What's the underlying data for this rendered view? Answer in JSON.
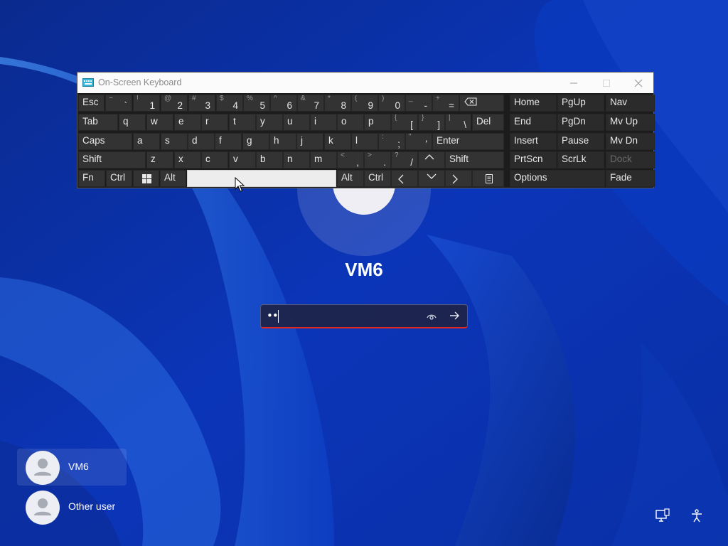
{
  "osk": {
    "title": "On-Screen Keyboard",
    "rows": [
      [
        {
          "id": "esc",
          "main": "Esc"
        },
        {
          "id": "backtick",
          "shift": "~",
          "main": "`"
        },
        {
          "id": "1",
          "shift": "!",
          "main": "1"
        },
        {
          "id": "2",
          "shift": "@",
          "main": "2"
        },
        {
          "id": "3",
          "shift": "#",
          "main": "3"
        },
        {
          "id": "4",
          "shift": "$",
          "main": "4"
        },
        {
          "id": "5",
          "shift": "%",
          "main": "5"
        },
        {
          "id": "6",
          "shift": "^",
          "main": "6"
        },
        {
          "id": "7",
          "shift": "&",
          "main": "7"
        },
        {
          "id": "8",
          "shift": "*",
          "main": "8"
        },
        {
          "id": "9",
          "shift": "(",
          "main": "9"
        },
        {
          "id": "0",
          "shift": ")",
          "main": "0"
        },
        {
          "id": "minus",
          "shift": "_",
          "main": "-"
        },
        {
          "id": "equals",
          "shift": "+",
          "main": "="
        },
        {
          "id": "backspace",
          "icon": "backspace-icon"
        }
      ],
      [
        {
          "id": "tab",
          "main": "Tab"
        },
        {
          "id": "q",
          "main": "q"
        },
        {
          "id": "w",
          "main": "w"
        },
        {
          "id": "e",
          "main": "e"
        },
        {
          "id": "r",
          "main": "r"
        },
        {
          "id": "t",
          "main": "t"
        },
        {
          "id": "y",
          "main": "y"
        },
        {
          "id": "u",
          "main": "u"
        },
        {
          "id": "i",
          "main": "i"
        },
        {
          "id": "o",
          "main": "o"
        },
        {
          "id": "p",
          "main": "p"
        },
        {
          "id": "lbracket",
          "shift": "{",
          "main": "["
        },
        {
          "id": "rbracket",
          "shift": "}",
          "main": "]"
        },
        {
          "id": "backslash",
          "shift": "|",
          "main": "\\"
        },
        {
          "id": "del",
          "main": "Del"
        }
      ],
      [
        {
          "id": "caps",
          "main": "Caps"
        },
        {
          "id": "a",
          "main": "a"
        },
        {
          "id": "s",
          "main": "s"
        },
        {
          "id": "d",
          "main": "d"
        },
        {
          "id": "f",
          "main": "f"
        },
        {
          "id": "g",
          "main": "g"
        },
        {
          "id": "h",
          "main": "h"
        },
        {
          "id": "j",
          "main": "j"
        },
        {
          "id": "k",
          "main": "k"
        },
        {
          "id": "l",
          "main": "l"
        },
        {
          "id": "semicolon",
          "shift": ":",
          "main": ";"
        },
        {
          "id": "quote",
          "shift": "\"",
          "main": "'"
        },
        {
          "id": "enter",
          "main": "Enter"
        }
      ],
      [
        {
          "id": "lshift",
          "main": "Shift"
        },
        {
          "id": "z",
          "main": "z"
        },
        {
          "id": "x",
          "main": "x"
        },
        {
          "id": "c",
          "main": "c"
        },
        {
          "id": "v",
          "main": "v"
        },
        {
          "id": "b",
          "main": "b"
        },
        {
          "id": "n",
          "main": "n"
        },
        {
          "id": "m",
          "main": "m"
        },
        {
          "id": "comma",
          "shift": "<",
          "main": ","
        },
        {
          "id": "period",
          "shift": ">",
          "main": "."
        },
        {
          "id": "slash",
          "shift": "?",
          "main": "/"
        },
        {
          "id": "up",
          "icon": "arrow-up-icon"
        },
        {
          "id": "rshift",
          "main": "Shift"
        }
      ],
      [
        {
          "id": "fn",
          "main": "Fn"
        },
        {
          "id": "lctrl",
          "main": "Ctrl"
        },
        {
          "id": "win",
          "icon": "windows-logo-icon"
        },
        {
          "id": "lalt",
          "main": "Alt"
        },
        {
          "id": "space",
          "main": ""
        },
        {
          "id": "ralt",
          "main": "Alt"
        },
        {
          "id": "rctrl",
          "main": "Ctrl"
        },
        {
          "id": "left",
          "icon": "arrow-left-icon"
        },
        {
          "id": "down",
          "icon": "arrow-down-icon"
        },
        {
          "id": "right",
          "icon": "arrow-right-icon"
        },
        {
          "id": "menu",
          "icon": "context-menu-icon"
        }
      ]
    ],
    "right_panel": [
      [
        {
          "id": "home",
          "main": "Home"
        },
        {
          "id": "pgup",
          "main": "PgUp"
        },
        {
          "id": "nav",
          "main": "Nav"
        }
      ],
      [
        {
          "id": "end",
          "main": "End"
        },
        {
          "id": "pgdn",
          "main": "PgDn"
        },
        {
          "id": "mvup",
          "main": "Mv Up"
        }
      ],
      [
        {
          "id": "insert",
          "main": "Insert"
        },
        {
          "id": "pause",
          "main": "Pause"
        },
        {
          "id": "mvdn",
          "main": "Mv Dn"
        }
      ],
      [
        {
          "id": "prtscn",
          "main": "PrtScn"
        },
        {
          "id": "scrlk",
          "main": "ScrLk"
        },
        {
          "id": "dock",
          "main": "Dock",
          "disabled": true
        }
      ],
      [
        {
          "id": "options",
          "main": "Options"
        },
        {
          "id": "fade",
          "main": "Fade"
        }
      ]
    ]
  },
  "login": {
    "username": "VM6",
    "password_masked": "••",
    "users": [
      "VM6",
      "Other user"
    ],
    "selected_user": "VM6"
  },
  "colors": {
    "wallpaper": "#0a2a9a",
    "key": "#333333",
    "osk_bg": "#1c1c1c",
    "password_underline": "#e0261e"
  }
}
